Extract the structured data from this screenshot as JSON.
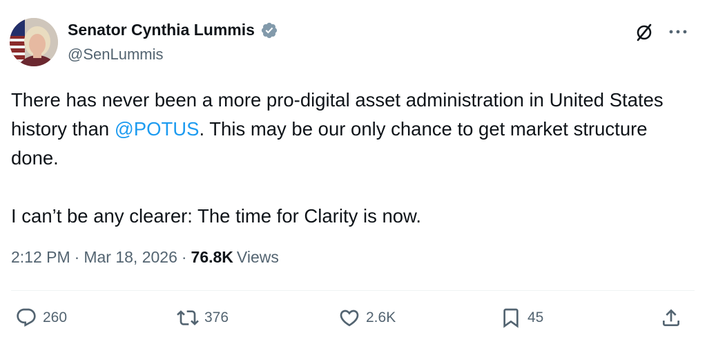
{
  "author": {
    "name": "Senator Cynthia Lummis",
    "handle": "@SenLummis",
    "avatar_icon": "profile-photo-with-flag",
    "verified_icon": "verified-badge-gray",
    "verified_color": "#829aab"
  },
  "tweet": {
    "text_before_mention": "There has never been a more pro-digital asset administration in United States history than ",
    "mention": "@POTUS",
    "text_after_mention": ". This may be our only chance to get market structure done.",
    "paragraph2": "I can’t be any clearer: The time for Clarity is now."
  },
  "meta": {
    "time": "2:12 PM",
    "separator": "·",
    "date": "Mar 18, 2026",
    "views_count": "76.8K",
    "views_label": "Views"
  },
  "actions": {
    "replies": "260",
    "reposts": "376",
    "likes": "2.6K",
    "bookmarks": "45"
  },
  "header_icons": {
    "grok": "grok-slash-circle-icon",
    "more": "more-dots-icon"
  },
  "colors": {
    "text": "#0f1419",
    "secondary": "#536471",
    "link": "#1d9bf0",
    "divider": "#eff3f4"
  }
}
